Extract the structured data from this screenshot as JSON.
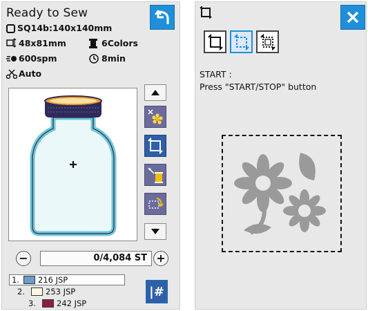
{
  "left": {
    "title": "Ready to Sew",
    "frame_size": "SQ14b:140x140mm",
    "design_size": "48x81mm",
    "colors": "6Colors",
    "speed": "600spm",
    "time": "8min",
    "thread_cut": "Auto",
    "stitch_counter": "0/4,084 ST",
    "color_list": [
      {
        "index": "1.",
        "color": "#6e9cc8",
        "label": "216 JSP"
      },
      {
        "index": "2.",
        "color": "#fdf8e2",
        "label": "253 JSP"
      },
      {
        "index": "3.",
        "color": "#8a2040",
        "label": "242 JSP"
      }
    ],
    "minus_label": "−",
    "plus_label": "+",
    "hash_label": "|#"
  },
  "right": {
    "start_line1": "START :",
    "start_line2": "Press \"START/STOP\" button"
  },
  "colors": {
    "accent": "#1f8fd9",
    "side_buttons": "#6c6c9c",
    "jar_outline": "#82d0dc",
    "jar_lid": "#2e2a5a",
    "flower": "#9a9a9a"
  }
}
